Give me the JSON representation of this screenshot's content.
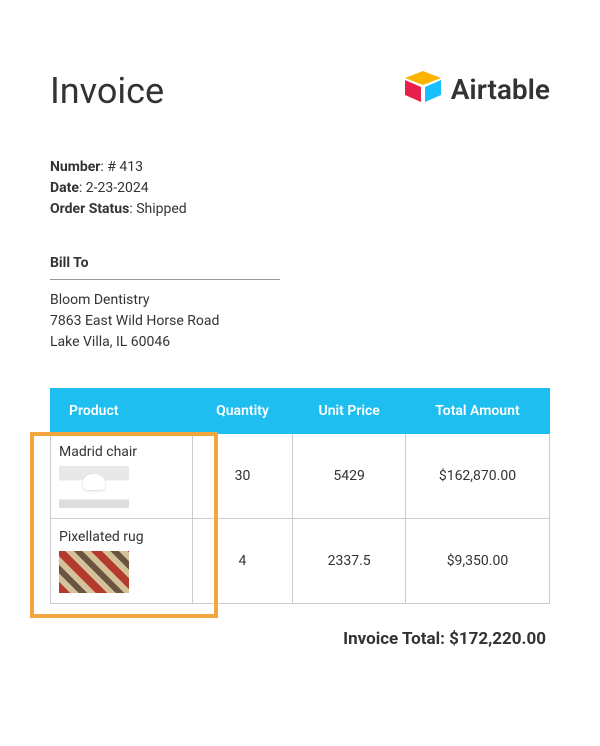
{
  "brand": {
    "name": "Airtable"
  },
  "title": "Invoice",
  "meta": {
    "number_label": "Number",
    "number_value": "# 413",
    "date_label": "Date",
    "date_value": "2-23-2024",
    "status_label": "Order Status",
    "status_value": "Shipped"
  },
  "bill_to": {
    "heading": "Bill To",
    "name": "Bloom Dentistry",
    "street": "7863 East Wild Horse Road",
    "city_line": "Lake Villa, IL 60046"
  },
  "columns": {
    "product": "Product",
    "quantity": "Quantity",
    "unit_price": "Unit Price",
    "total": "Total Amount"
  },
  "line_items": [
    {
      "product": "Madrid chair",
      "quantity": "30",
      "unit_price": "5429",
      "total": "$162,870.00"
    },
    {
      "product": "Pixellated rug",
      "quantity": "4",
      "unit_price": "2337.5",
      "total": "$9,350.00"
    }
  ],
  "invoice_total": {
    "label": "Invoice Total:",
    "value": "$172,220.00"
  }
}
